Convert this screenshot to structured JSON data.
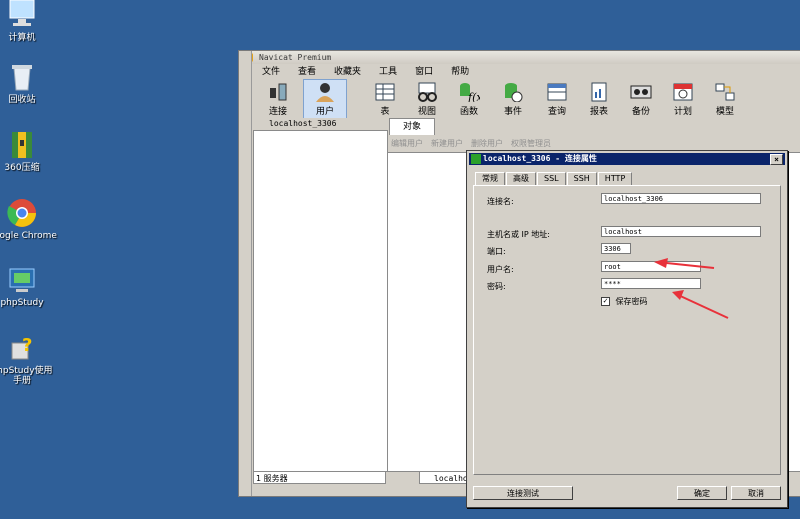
{
  "desktop": {
    "icons": [
      {
        "label": "计算机"
      },
      {
        "label": "回收站"
      },
      {
        "label": "360压缩"
      },
      {
        "label": "Google Chrome"
      },
      {
        "label": "phpStudy"
      },
      {
        "label": "phpStudy使用手册"
      }
    ]
  },
  "navicat": {
    "title": "Navicat Premium",
    "menu": [
      "文件",
      "查看",
      "收藏夹",
      "工具",
      "窗口",
      "帮助"
    ],
    "toolbar": [
      "连接",
      "用户",
      "表",
      "视图",
      "函数",
      "事件",
      "查询",
      "报表",
      "备份",
      "计划",
      "模型"
    ],
    "connection_tab": "localhost_3306",
    "objects_tab": "对象",
    "object_actions": [
      "编辑用户",
      "新建用户",
      "删除用户",
      "权限管理员"
    ],
    "status_left": "1 服务器",
    "status_right": "localhost"
  },
  "dialog": {
    "title": "localhost_3306 - 连接属性",
    "close_glyph": "×",
    "tabs": [
      "常规",
      "高级",
      "SSL",
      "SSH",
      "HTTP"
    ],
    "fields": {
      "conn_name_label": "连接名:",
      "conn_name_value": "localhost_3306",
      "host_label": "主机名或 IP 地址:",
      "host_value": "localhost",
      "port_label": "端口:",
      "port_value": "3306",
      "user_label": "用户名:",
      "user_value": "root",
      "password_label": "密码:",
      "password_value": "****",
      "save_password_label": "保存密码",
      "save_password_checked": true,
      "check_glyph": "✓"
    },
    "buttons": {
      "test": "连接测试",
      "ok": "确定",
      "cancel": "取消"
    }
  },
  "colors": {
    "desktop": "#2f5f98",
    "annotation_arrow": "#e8313a",
    "dialog_title": "#0a246a"
  }
}
